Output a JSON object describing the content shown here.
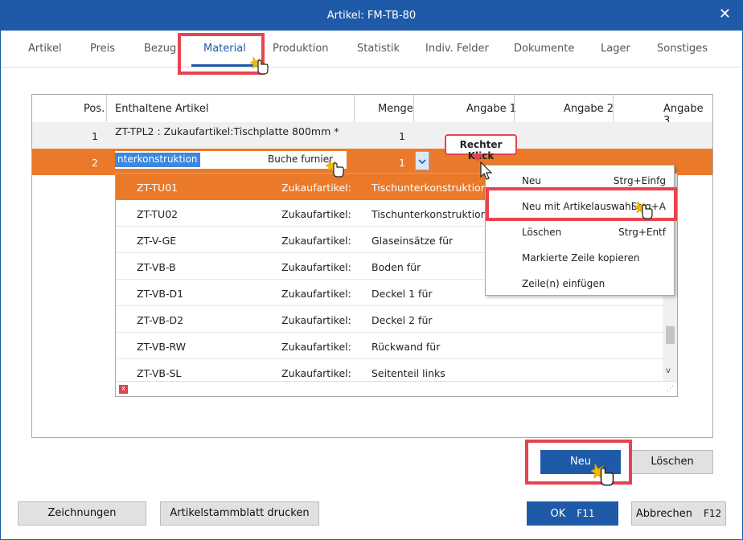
{
  "window": {
    "title": "Artikel: FM-TB-80",
    "close_glyph": "✕"
  },
  "tabs": [
    {
      "label": "Artikel"
    },
    {
      "label": "Preis"
    },
    {
      "label": "Bezug"
    },
    {
      "label": "Material",
      "active": true
    },
    {
      "label": "Produktion"
    },
    {
      "label": "Statistik"
    },
    {
      "label": "Indiv. Felder"
    },
    {
      "label": "Dokumente"
    },
    {
      "label": "Lager"
    },
    {
      "label": "Sonstiges"
    }
  ],
  "grid": {
    "headers": {
      "pos": "Pos.",
      "article": "Enthaltene Artikel",
      "qty": "Menge",
      "a1": "Angabe 1",
      "a2": "Angabe 2",
      "a3": "Angabe 3"
    },
    "rows": [
      {
        "pos": "1",
        "article": "ZT-TPL2 : Zukaufartikel:Tischplatte 800mm *",
        "qty": "1"
      },
      {
        "pos": "2",
        "article_edit": "nterkonstruktion",
        "article_suffix": "Buche furnier",
        "qty": "1"
      }
    ]
  },
  "dropdown": {
    "items": [
      {
        "code": "ZT-TU01",
        "type": "Zukaufartikel:",
        "desc": "Tischunterkonstruktion"
      },
      {
        "code": "ZT-TU02",
        "type": "Zukaufartikel:",
        "desc": "Tischunterkonstruktion"
      },
      {
        "code": "ZT-V-GE",
        "type": "Zukaufartikel:",
        "desc": "Glaseinsätze für"
      },
      {
        "code": "ZT-VB-B",
        "type": "Zukaufartikel:",
        "desc": "Boden für"
      },
      {
        "code": "ZT-VB-D1",
        "type": "Zukaufartikel:",
        "desc": "Deckel 1 für"
      },
      {
        "code": "ZT-VB-D2",
        "type": "Zukaufartikel:",
        "desc": "Deckel 2 für"
      },
      {
        "code": "ZT-VB-RW",
        "type": "Zukaufartikel:",
        "desc": "Rückwand für"
      },
      {
        "code": "ZT-VB-SL",
        "type": "Zukaufartikel:",
        "desc": "Seitenteil links"
      }
    ],
    "clear_glyph": "x",
    "scroll_down_glyph": "v"
  },
  "callout": {
    "text": "Rechter Klick"
  },
  "context_menu": [
    {
      "label": "Neu",
      "shortcut": "Strg+Einfg"
    },
    {
      "label": "Neu mit Artikelauswahl",
      "shortcut": "Strg+A"
    },
    {
      "label": "Löschen",
      "shortcut": "Strg+Entf"
    },
    {
      "label": "Markierte Zeile kopieren",
      "shortcut": ""
    },
    {
      "label": "Zeile(n) einfügen",
      "shortcut": ""
    }
  ],
  "buttons": {
    "neu": "Neu",
    "loeschen": "Löschen",
    "zeichnungen": "Zeichnungen",
    "artikelstammblatt": "Artikelstammblatt drucken",
    "ok": "OK",
    "ok_key": "F11",
    "abbrechen": "Abbrechen",
    "abbrechen_key": "F12"
  },
  "colors": {
    "accent": "#1e5aa8",
    "selection": "#ea7a2a",
    "highlight": "#e8434f"
  }
}
